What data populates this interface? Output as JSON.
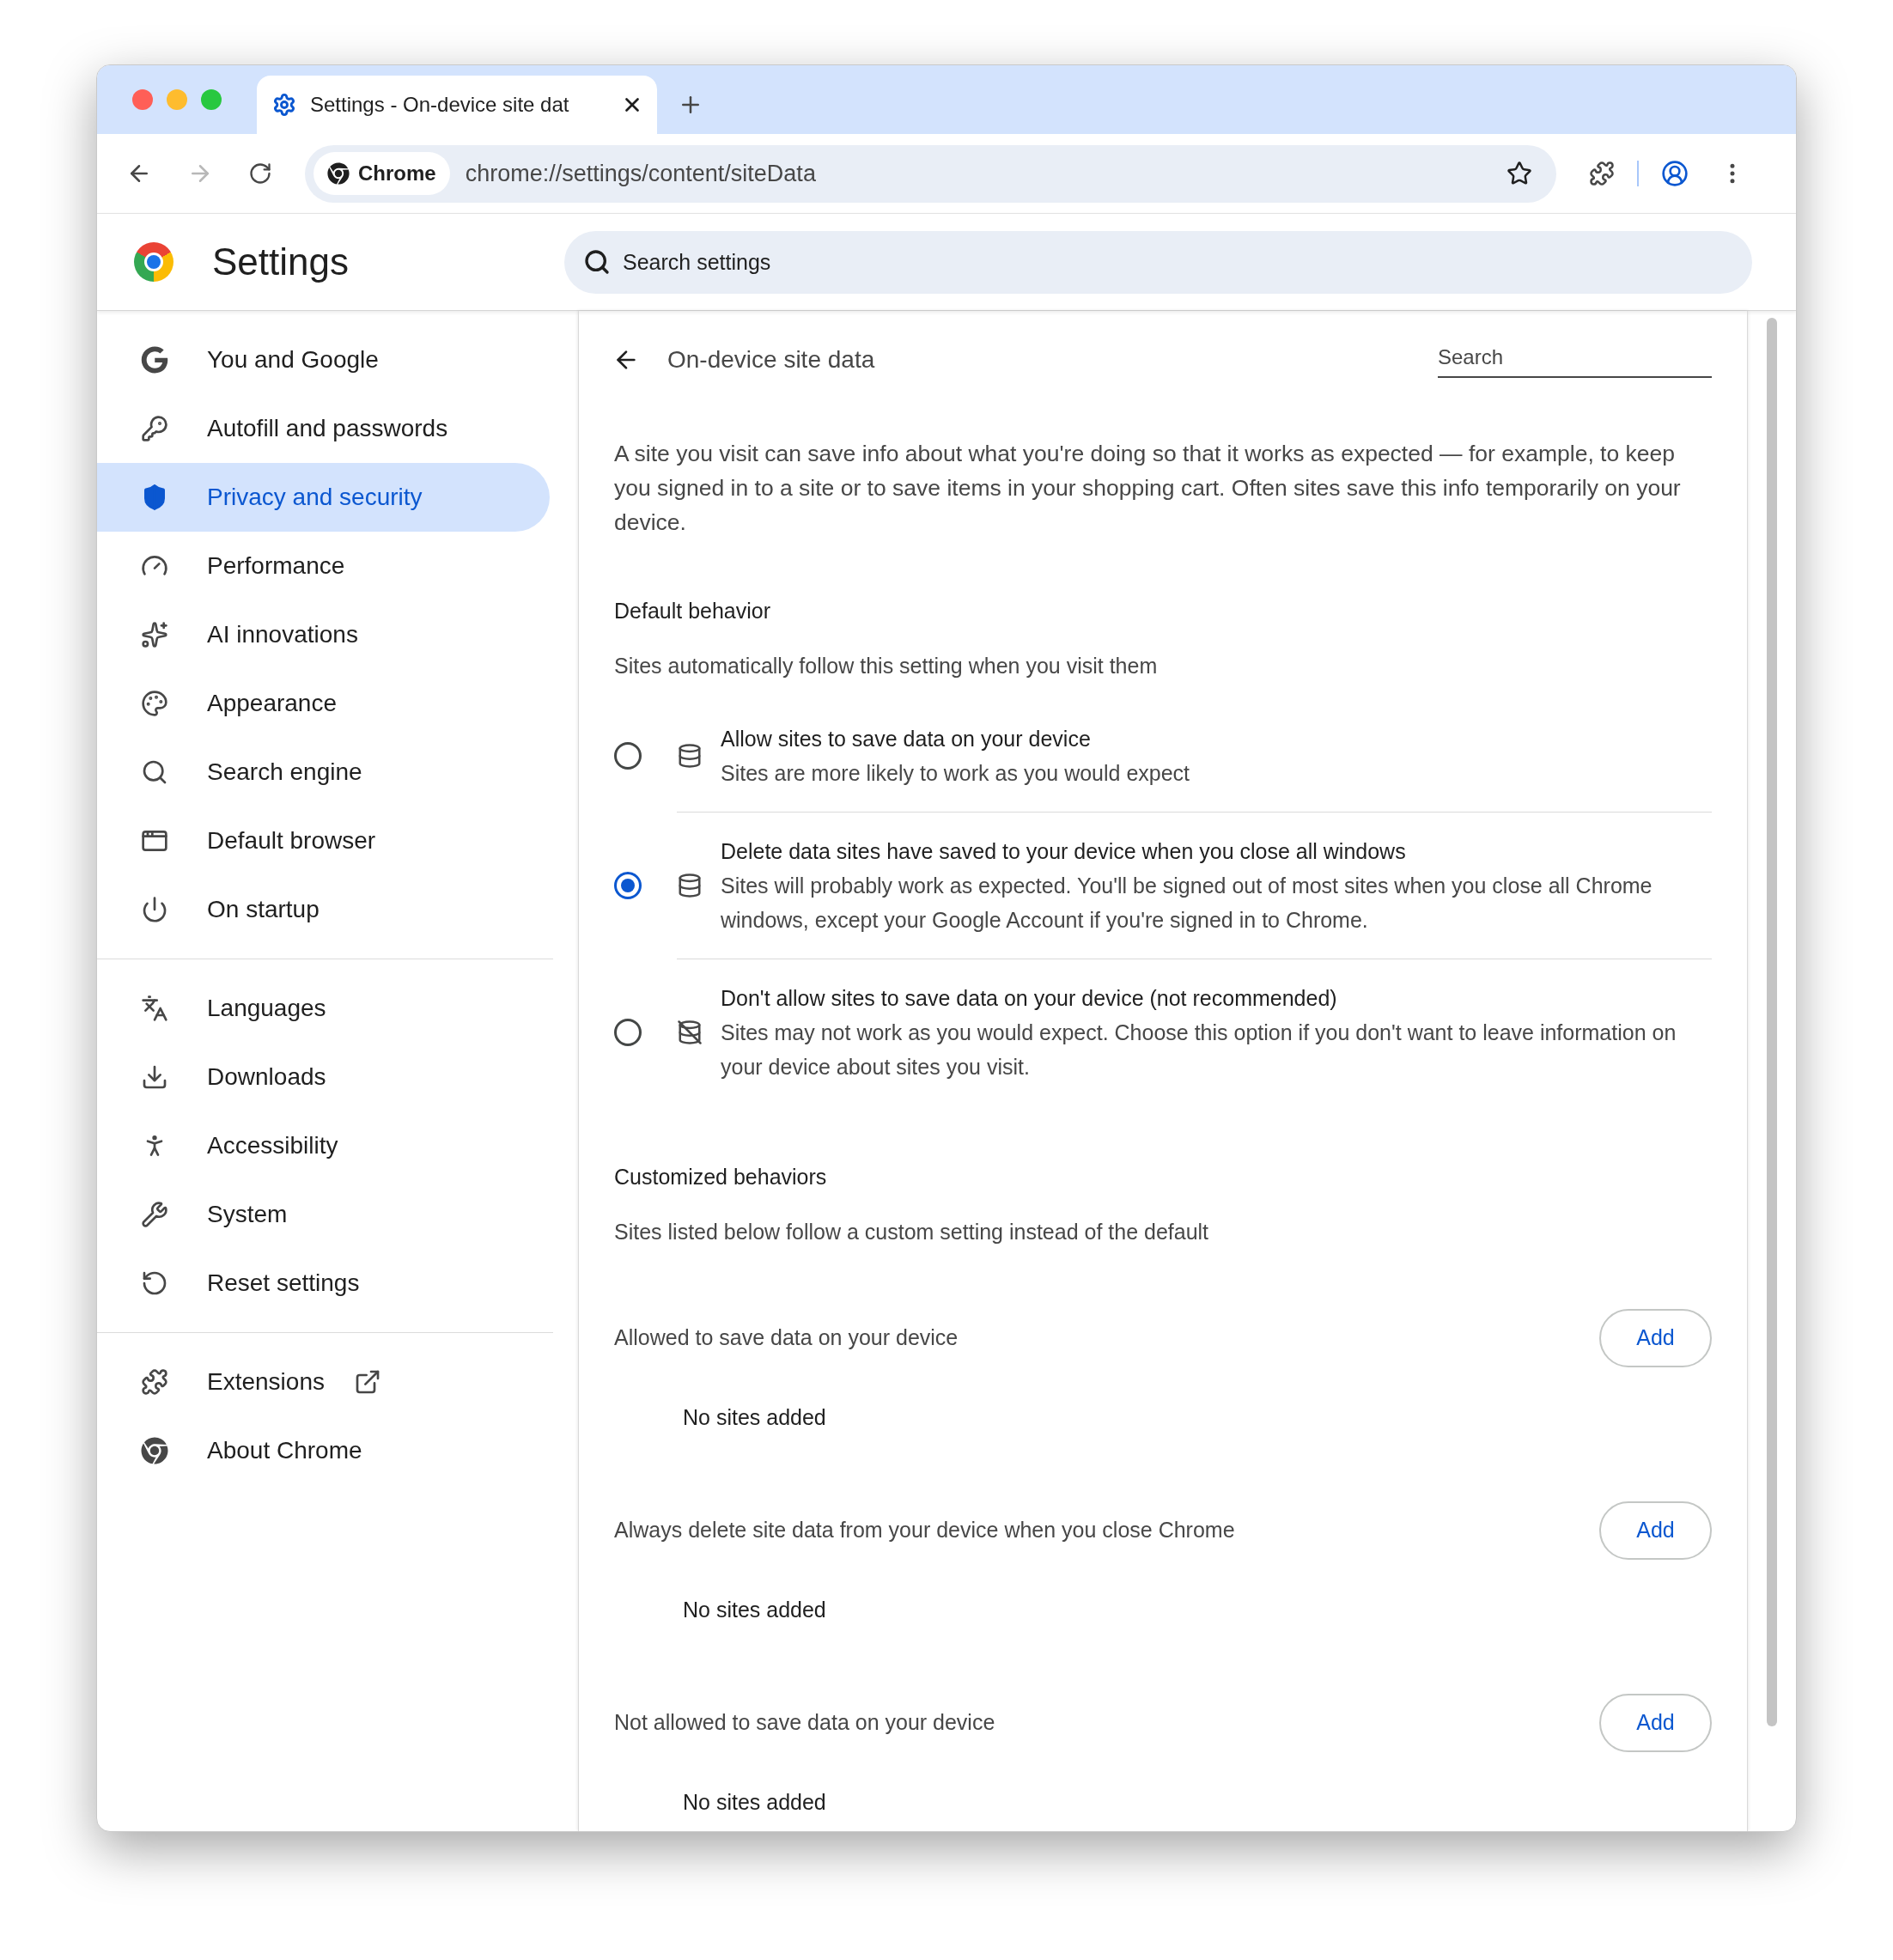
{
  "tab": {
    "title": "Settings - On-device site dat",
    "selected": true
  },
  "toolbar": {
    "back": {
      "disabled": false
    },
    "forward": {
      "disabled": true
    },
    "site_chip": "Chrome",
    "url": "chrome://settings/content/siteData"
  },
  "header": {
    "title": "Settings",
    "search": {
      "placeholder": "Search settings"
    }
  },
  "sidebar": {
    "groups": [
      {
        "items": [
          {
            "label": "You and Google",
            "selected": false
          },
          {
            "label": "Autofill and passwords",
            "selected": false
          },
          {
            "label": "Privacy and security",
            "selected": true
          },
          {
            "label": "Performance",
            "selected": false
          },
          {
            "label": "AI innovations",
            "selected": false
          },
          {
            "label": "Appearance",
            "selected": false
          },
          {
            "label": "Search engine",
            "selected": false
          },
          {
            "label": "Default browser",
            "selected": false
          },
          {
            "label": "On startup",
            "selected": false
          }
        ]
      },
      {
        "items": [
          {
            "label": "Languages",
            "selected": false
          },
          {
            "label": "Downloads",
            "selected": false
          },
          {
            "label": "Accessibility",
            "selected": false
          },
          {
            "label": "System",
            "selected": false
          },
          {
            "label": "Reset settings",
            "selected": false
          }
        ]
      },
      {
        "items": [
          {
            "label": "Extensions",
            "selected": false
          },
          {
            "label": "About Chrome",
            "selected": false
          }
        ]
      }
    ]
  },
  "page": {
    "title": "On-device site data",
    "search": {
      "placeholder": "Search"
    },
    "intro": "A site you visit can save info about what you're doing so that it works as expected — for example, to keep you signed in to a site or to save items in your shopping cart. Often sites save this info temporarily on your device.",
    "default_behavior": {
      "heading": "Default behavior",
      "description": "Sites automatically follow this setting when you visit them",
      "options": [
        {
          "title": "Allow sites to save data on your device",
          "description": "Sites are more likely to work as you would expect",
          "selected": false
        },
        {
          "title": "Delete data sites have saved to your device when you close all windows",
          "description": "Sites will probably work as expected. You'll be signed out of most sites when you close all Chrome windows, except your Google Account if you're signed in to Chrome.",
          "selected": true
        },
        {
          "title": "Don't allow sites to save data on your device (not recommended)",
          "description": "Sites may not work as you would expect. Choose this option if you don't want to leave information on your device about sites you visit.",
          "selected": false
        }
      ]
    },
    "customized_behaviors": {
      "heading": "Customized behaviors",
      "description": "Sites listed below follow a custom setting instead of the default",
      "lists": [
        {
          "label": "Allowed to save data on your device",
          "button": "Add",
          "empty": "No sites added"
        },
        {
          "label": "Always delete site data from your device when you close Chrome",
          "button": "Add",
          "empty": "No sites added"
        },
        {
          "label": "Not allowed to save data on your device",
          "button": "Add",
          "empty": "No sites added"
        }
      ]
    }
  }
}
